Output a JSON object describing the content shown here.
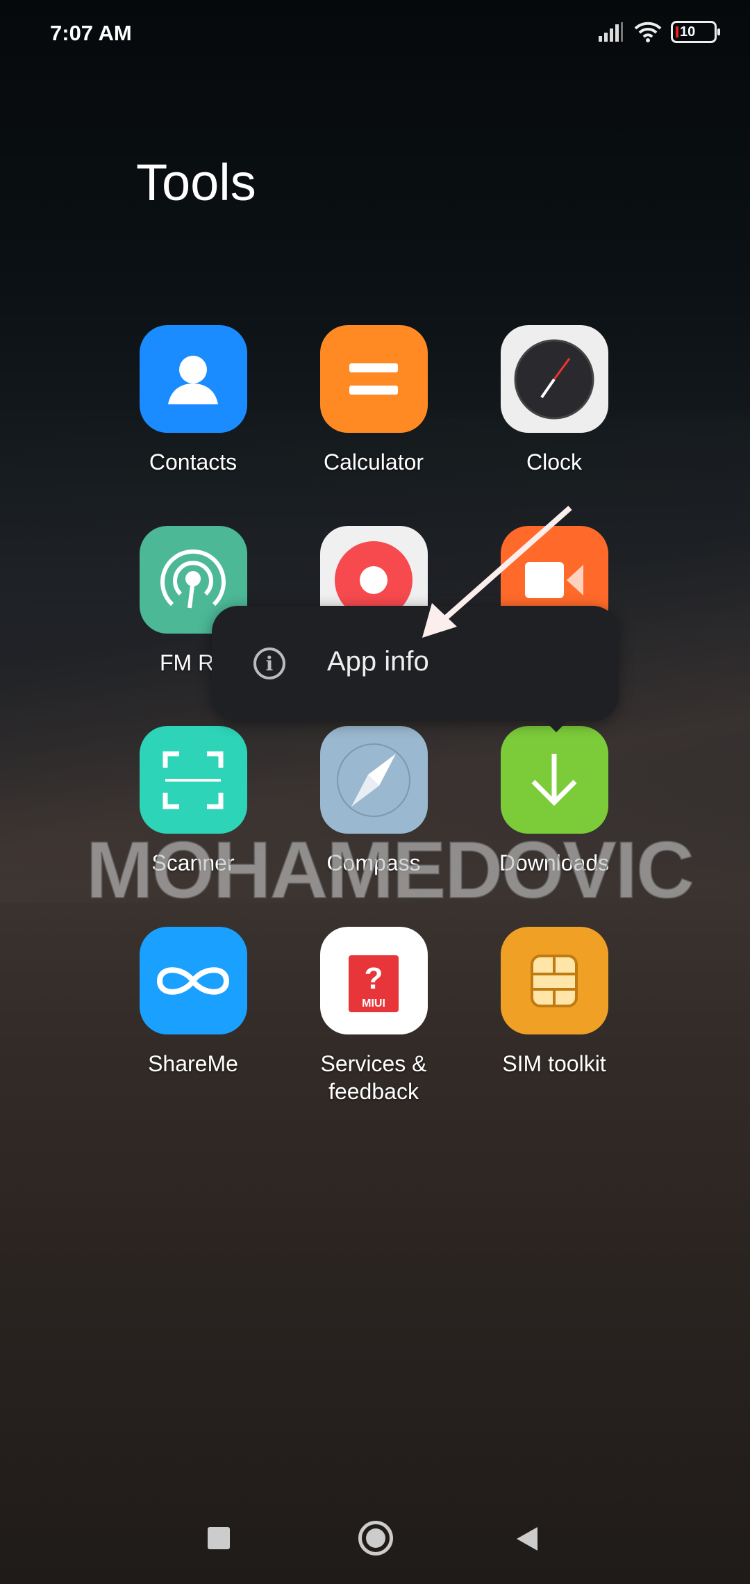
{
  "status_bar": {
    "time": "7:07 AM",
    "battery": "10",
    "icons": [
      "signal-icon",
      "wifi-icon",
      "battery-icon"
    ]
  },
  "folder": {
    "title": "Tools"
  },
  "apps": [
    {
      "label": "Contacts",
      "icon": "contacts-icon",
      "color": "#1a8cff"
    },
    {
      "label": "Calculator",
      "icon": "calculator-icon",
      "color": "#ff8a24"
    },
    {
      "label": "Clock",
      "icon": "clock-icon",
      "color": "#eeeeee"
    },
    {
      "label": "FM Ra",
      "icon": "radio-icon",
      "color": "#4cb896"
    },
    {
      "label": "",
      "icon": "recorder-icon",
      "color": "#f0f0f0"
    },
    {
      "label": "",
      "icon": "screen-recorder-icon",
      "color": "#ff6a2a"
    },
    {
      "label": "Scanner",
      "icon": "scanner-icon",
      "color": "#2dd4b8"
    },
    {
      "label": "Compass",
      "icon": "compass-icon",
      "color": "#9ab8cf"
    },
    {
      "label": "Downloads",
      "icon": "download-icon",
      "color": "#7ccc3a"
    },
    {
      "label": "ShareMe",
      "icon": "shareme-icon",
      "color": "#1aa0ff"
    },
    {
      "label": "Services & feedback",
      "icon": "services-feedback-icon",
      "color": "#ffffff"
    },
    {
      "label": "SIM toolkit",
      "icon": "sim-icon",
      "color": "#f0a024"
    }
  ],
  "popup": {
    "item": "App info",
    "icon": "info-icon"
  },
  "watermark": "MOHAMEDOVIC",
  "services_badge": "MIUI",
  "nav": [
    "recents-button",
    "home-button",
    "back-button"
  ]
}
